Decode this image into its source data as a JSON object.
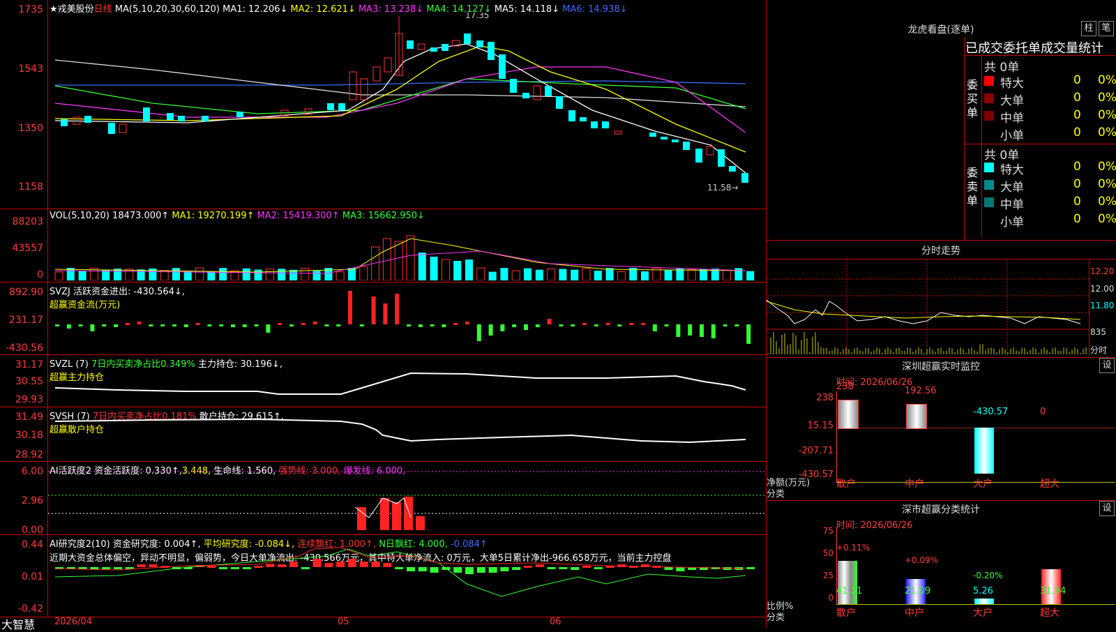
{
  "stock": {
    "name": "★戎美股份",
    "period": "日线",
    "ma_params": "MA(5,10,20,30,60,120)",
    "ma1": "MA1: 12.206↓",
    "ma2": "MA2: 12.621↓",
    "ma3": "MA3: 13.238↓",
    "ma4": "MA4: 14.127↓",
    "ma5": "MA5: 14.118↓",
    "ma6": "MA6: 14.938↓",
    "high_label": "17.35",
    "low_label": "11.58→",
    "axis": [
      "1735",
      "1543",
      "1350",
      "1158"
    ]
  },
  "vol": {
    "title": "VOL(5,10,20)",
    "value": "18473.000↑",
    "ma1": "MA1: 19270.199↑",
    "ma2": "MA2: 15419.300↑",
    "ma3": "MA3: 15662.950↓",
    "axis": [
      "88203",
      "43557",
      "0"
    ]
  },
  "svzj": {
    "title": "SVZJ  活跃资金进出: -430.564↓,",
    "subtitle": "超赢资金流(万元)",
    "axis": [
      "892.90",
      "231.17",
      "-430.56"
    ]
  },
  "svzl": {
    "title": "SVZL (7)",
    "t2": "7日内买卖净占比0.349%",
    "t3": "主力持仓: 30.196↓,",
    "subtitle": "超赢主力持仓",
    "axis": [
      "31.17",
      "30.55",
      "29.93"
    ]
  },
  "svsh": {
    "title": "SVSH (7)",
    "t2": "7日内买卖净占比0.181%",
    "t3": "散户持仓: 29.615↑,",
    "subtitle": "超赢散户持仓",
    "axis": [
      "31.49",
      "30.18",
      "28.92"
    ]
  },
  "ai1": {
    "title": "AI活跃度2",
    "t2": "资金活跃度: 0.330↑,",
    "t3": "3.448,",
    "t4": "生命线: 1.560,",
    "t5": "强势线: 3.000,",
    "t6": "爆发线: 6.000,",
    "axis": [
      "6.00",
      "2.96",
      "0.00"
    ]
  },
  "ai2": {
    "title": "AI研究度2(10)",
    "t2": "资金研究度: 0.004↑,",
    "t3": "平均研究度: -0.084↓,",
    "t4": "连续飘红: 1.000↑,",
    "t5": "N日飘红: 4.000,",
    "t6": "-0.084↑",
    "summary": "近期大资金总体偏空，异动不明显，偏弱势，今日大单净流出: -430.566万元，其中特大单净流入: 0万元，大单5日累计净出-966.658万元，当前主力控盘",
    "axis": [
      "0.44",
      "0.01",
      "-0.42"
    ]
  },
  "footer": {
    "brand": "大智慧",
    "date": "2026/04",
    "m05": "05",
    "m06": "06"
  },
  "dragon": {
    "title": "龙虎看盘(逐单)",
    "btn1": "柱",
    "btn2": "笔",
    "tabs": "已成交委托单成交量统计",
    "buy_label": "委买单",
    "sell_label": "委卖单",
    "buy_total": "共 0单",
    "sell_total": "共 0单",
    "buy_rows": [
      {
        "name": "特大",
        "v": "0",
        "p": "0%"
      },
      {
        "name": "大单",
        "v": "0",
        "p": "0%"
      },
      {
        "name": "中单",
        "v": "0",
        "p": "0%"
      },
      {
        "name": "小单",
        "v": "0",
        "p": "0%"
      }
    ],
    "sell_rows": [
      {
        "name": "特大",
        "v": "0",
        "p": "0%"
      },
      {
        "name": "大单",
        "v": "0",
        "p": "0%"
      },
      {
        "name": "中单",
        "v": "0",
        "p": "0%"
      },
      {
        "name": "小单",
        "v": "0",
        "p": "0%"
      }
    ]
  },
  "intraday": {
    "title": "分时走势",
    "axis": [
      "12.20",
      "12.00",
      "11.80",
      "835",
      "分时"
    ]
  },
  "sz_monitor": {
    "title": "深圳超赢实时监控",
    "btn": "设",
    "time": "时间: 2026/06/26",
    "axis": [
      "238",
      "15.15",
      "-207.71",
      "-430.57"
    ],
    "ylabel": "净额(万元)",
    "xlabel": "分类",
    "cats": [
      "散户",
      "中户",
      "大户",
      "超大"
    ],
    "values": [
      "238",
      "192.56",
      "-430.57",
      "0"
    ]
  },
  "sz_stats": {
    "title": "深市超赢分类统计",
    "btn": "设",
    "time": "时间: 2026/06/26",
    "axis": [
      "75",
      "50",
      "25",
      "0"
    ],
    "ylabel": "比例%",
    "xlabel": "分类",
    "cats": [
      "散户",
      "中户",
      "大户",
      "超大"
    ],
    "values": [
      "41.11",
      "21.09",
      "5.26",
      "31.94"
    ],
    "pcts": [
      "+0.11%",
      "+0.09%",
      "-0.20%",
      ""
    ]
  }
}
